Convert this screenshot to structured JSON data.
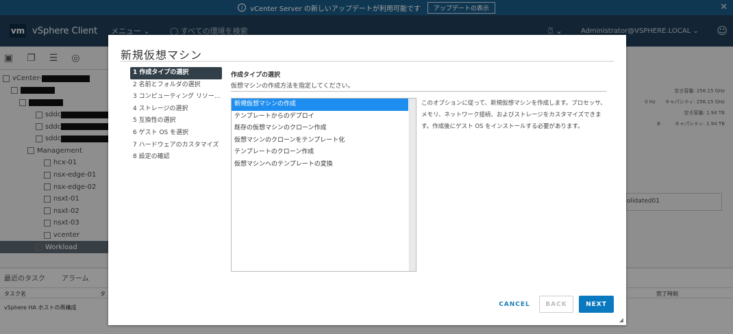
{
  "banner": {
    "message": "vCenter Server の新しいアップデートが利用可能です",
    "button": "アップデートの表示",
    "info_icon": "i",
    "close_icon": "✕"
  },
  "header": {
    "logo": "vm",
    "title": "vSphere Client",
    "menu": "メニュー ⌄",
    "search_placeholder": "◯ すべての環境を検索",
    "help": "⍰ ⌄",
    "user": "Administrator@VSPHERE.LOCAL ⌄",
    "smiley": "☺"
  },
  "bg": {
    "tree": [
      {
        "label": "vCenter-",
        "indent": 0
      },
      {
        "label": "",
        "indent": 1
      },
      {
        "label": "",
        "indent": 2
      },
      {
        "label": "sddc",
        "indent": 4
      },
      {
        "label": "sddc",
        "indent": 4
      },
      {
        "label": "sddc",
        "indent": 4
      },
      {
        "label": "Management",
        "indent": 3
      },
      {
        "label": "hcx-01",
        "indent": 5
      },
      {
        "label": "nsx-edge-01",
        "indent": 5
      },
      {
        "label": "nsx-edge-02",
        "indent": 5
      },
      {
        "label": "nsxt-01",
        "indent": 5
      },
      {
        "label": "nsxt-02",
        "indent": 5
      },
      {
        "label": "nsxt-03",
        "indent": 5
      },
      {
        "label": "vcenter",
        "indent": 5
      },
      {
        "label": "Workload",
        "indent": 4
      }
    ],
    "tasks_tabs": [
      "最近のタスク",
      "アラーム"
    ],
    "tasks_cols": {
      "name": "タスク名",
      "target": "タ",
      "completed": "完了時刻"
    },
    "task_row": "vSphere HA ホストの再構成",
    "right_stats": [
      "空き容量: 256.15 GHz",
      "0 Hz　　キャパシティ: 256.15 GHz",
      "空き容量: 1.94 TB",
      "B　　　キャパシティ: 1.94 TB"
    ],
    "consolidated": "olidated01"
  },
  "modal": {
    "title": "新規仮想マシン",
    "steps": [
      "1 作成タイプの選択",
      "2 名前とフォルダの選択",
      "3 コンピューティング リソー...",
      "4 ストレージの選択",
      "5 互換性の選択",
      "6 ゲスト OS を選択",
      "7 ハードウェアのカスタマイズ",
      "8 設定の確認"
    ],
    "content_title": "作成タイプの選択",
    "content_subtitle": "仮想マシンの作成方法を指定してください。",
    "options": [
      "新規仮想マシンの作成",
      "テンプレートからのデプロイ",
      "既存の仮想マシンのクローン作成",
      "仮想マシンのクローンをテンプレート化",
      "テンプレートのクローン作成",
      "仮想マシンへのテンプレートの変換"
    ],
    "description": "このオプションに従って、新規仮想マシンを作成します。プロセッサ、メモリ、ネットワーク接続、およびストレージをカスタマイズできます。作成後にゲスト OS をインストールする必要があります。",
    "cancel": "CANCEL",
    "back": "BACK",
    "next": "NEXT",
    "resize_icon": "◢"
  }
}
